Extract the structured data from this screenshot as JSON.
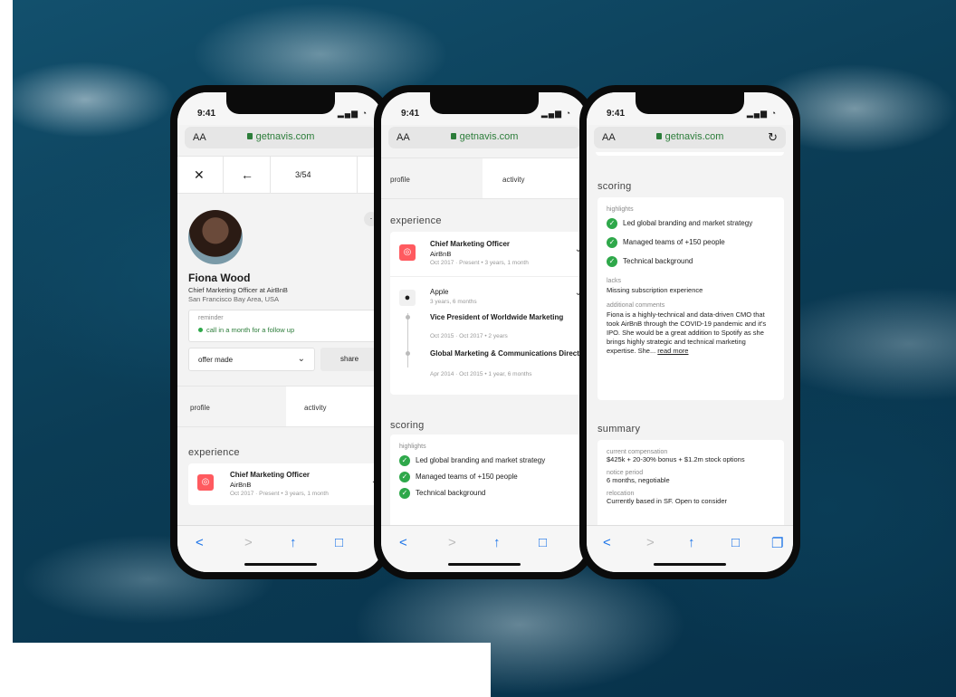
{
  "browser": {
    "time": "9:41",
    "signal": "▂▄▆ ◔",
    "text_size": "AA",
    "url": "getnavis.com",
    "reload": "↻"
  },
  "toolbar": {
    "back": "<",
    "forward": ">",
    "share": "↑",
    "bookmarks": "□",
    "tabs": "❐"
  },
  "phone1": {
    "nav": {
      "close": "✕",
      "back": "←",
      "counter": "3/54"
    },
    "profile": {
      "name": "Fiona Wood",
      "title": "Chief Marketing Officer at AirBnB",
      "location": "San Francisco Bay Area, USA"
    },
    "reminder": {
      "label": "reminder",
      "text": "call in a month for a follow up"
    },
    "status": {
      "value": "offer made",
      "share": "share"
    },
    "tabs": {
      "profile": "profile",
      "activity": "activity"
    },
    "experience": {
      "heading": "experience",
      "role": "Chief Marketing Officer",
      "company": "AirBnB",
      "dates": "Oct 2017 · Present • 3 years, 1 month"
    }
  },
  "phone2": {
    "tabs": {
      "profile": "profile",
      "activity": "activity"
    },
    "experience": {
      "heading": "experience",
      "airbnb": {
        "role": "Chief Marketing Officer",
        "company": "AirBnB",
        "dates": "Oct 2017 · Present • 3 years, 1 month"
      },
      "apple": {
        "company": "Apple",
        "duration": "3 years, 6 months",
        "roles": [
          {
            "title": "Vice President of Worldwide Marketing",
            "dates": "Oct 2015 · Oct 2017 • 2 years"
          },
          {
            "title": "Global Marketing & Communications Director",
            "dates": "Apr 2014 · Oct 2015 • 1 year, 6 months"
          }
        ]
      }
    },
    "scoring": {
      "heading": "scoring",
      "highlights_label": "highlights",
      "highlights": [
        "Led global branding and market strategy",
        "Managed teams of +150 people",
        "Technical background"
      ]
    }
  },
  "phone3": {
    "scoring": {
      "heading": "scoring",
      "highlights_label": "highlights",
      "highlights": [
        "Led global branding and market strategy",
        "Managed teams of +150 people",
        "Technical background"
      ],
      "lacks_label": "lacks",
      "lacks": "Missing subscription experience",
      "comments_label": "additional comments",
      "comments": "Fiona is a highly-technical and data-driven CMO that took AirBnB through the COVID-19 pandemic and it's IPO. She would be a great addition to Spotify as she brings highly strategic and technical marketing expertise. She...",
      "read_more": "read more"
    },
    "summary": {
      "heading": "summary",
      "comp_label": "current compensation",
      "comp": "$425k + 20-30% bonus + $1.2m stock options",
      "notice_label": "notice period",
      "notice": "6 months, negotiable",
      "relocation_label": "relocation",
      "relocation": "Currently based in SF. Open to consider"
    }
  },
  "colors": {
    "accent_green": "#2ea84a",
    "link_blue": "#1a73e8",
    "airbnb_red": "#ff5a5f"
  }
}
